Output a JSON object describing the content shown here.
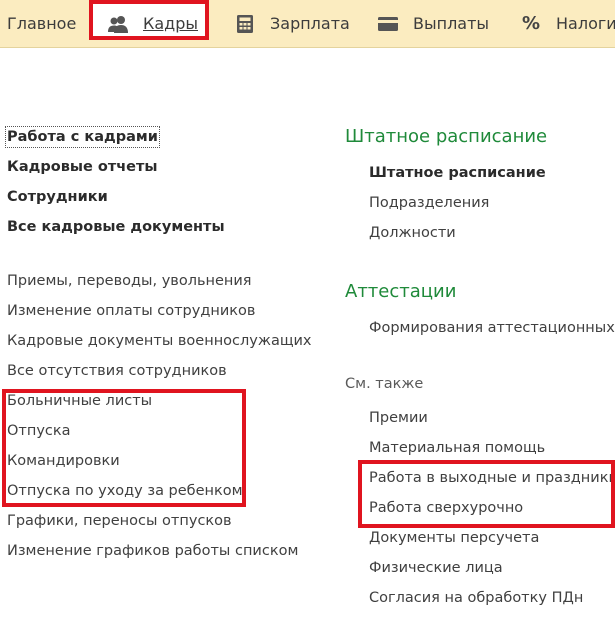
{
  "topbar": {
    "tabs": [
      {
        "label": "Главное"
      },
      {
        "label": "Кадры"
      },
      {
        "label": "Зарплата"
      },
      {
        "label": "Выплаты"
      },
      {
        "label": "Налоги и"
      }
    ],
    "percent_glyph": "%"
  },
  "left": {
    "bold_links": [
      "Работа с кадрами",
      "Кадровые отчеты",
      "Сотрудники",
      "Все кадровые документы"
    ],
    "links": [
      "Приемы, переводы, увольнения",
      "Изменение оплаты сотрудников",
      "Кадровые документы военнослужащих",
      "Все отсутствия сотрудников",
      "Больничные листы",
      "Отпуска",
      "Командировки",
      "Отпуска по уходу за ребенком",
      "Графики, переносы отпусков",
      "Изменение графиков работы списком"
    ]
  },
  "right": {
    "staffing": {
      "title": "Штатное расписание",
      "links": [
        "Штатное расписание",
        "Подразделения",
        "Должности"
      ]
    },
    "attestation": {
      "title": "Аттестации",
      "links": [
        "Формирования аттестационных ко"
      ]
    },
    "see_also": {
      "title": "См. также",
      "links": [
        "Премии",
        "Материальная помощь",
        "Работа в выходные и праздники",
        "Работа сверхурочно",
        "Документы персучета",
        "Физические лица",
        "Согласия на обработку ПДн"
      ]
    }
  },
  "colors": {
    "topbar_bg": "#fbecc0",
    "section_title": "#1f8a3a",
    "highlight_red": "#e0141f"
  }
}
